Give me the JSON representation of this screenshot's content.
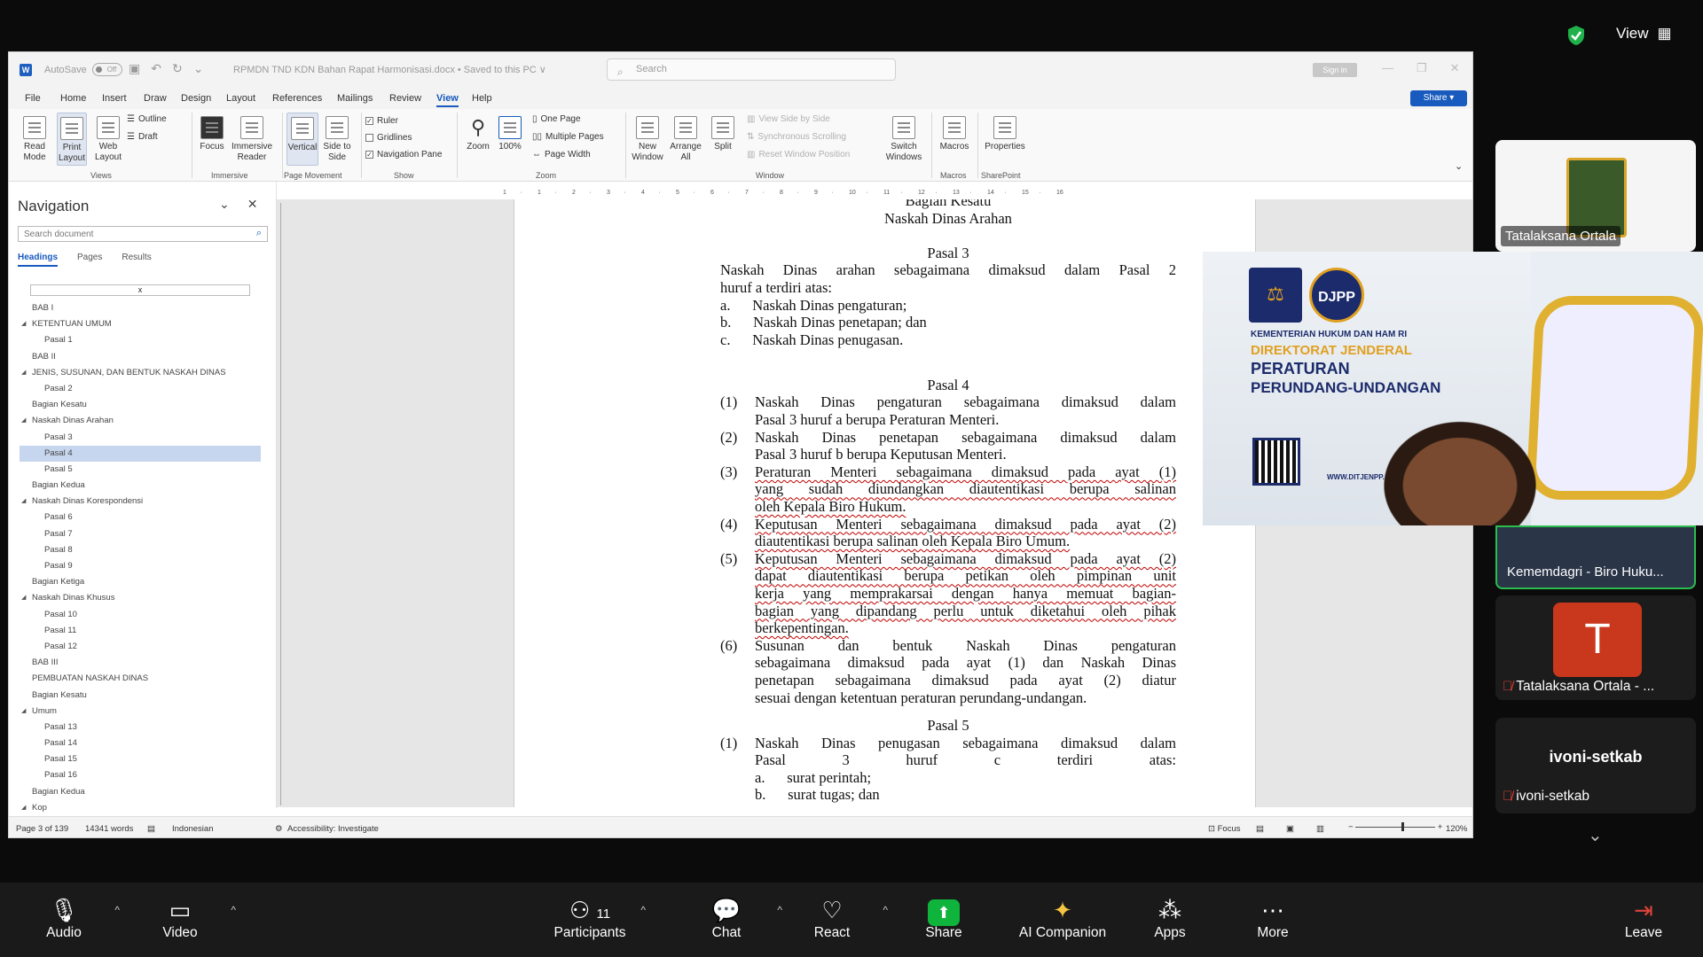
{
  "zoom_top": {
    "view_label": "View"
  },
  "word": {
    "autosave_label": "AutoSave",
    "autosave_state": "Off",
    "doc_title": "RPMDN TND KDN Bahan Rapat Harmonisasi.docx • Saved to this PC ∨",
    "search_placeholder": "Search",
    "sign_in": "Sign in",
    "share": "Share ▾",
    "menu": [
      "File",
      "Home",
      "Insert",
      "Draw",
      "Design",
      "Layout",
      "References",
      "Mailings",
      "Review",
      "View",
      "Help"
    ],
    "ribbon": {
      "views": {
        "read_mode": "Read Mode",
        "print_layout": "Print Layout",
        "web_layout": "Web Layout",
        "outline": "Outline",
        "draft": "Draft",
        "group": "Views"
      },
      "immersive": {
        "focus": "Focus",
        "immersive_reader": "Immersive Reader",
        "group": "Immersive"
      },
      "page_movement": {
        "vertical": "Vertical",
        "side_to_side": "Side to Side",
        "group": "Page Movement"
      },
      "show": {
        "ruler": "Ruler",
        "gridlines": "Gridlines",
        "navigation_pane": "Navigation Pane",
        "group": "Show"
      },
      "zoom": {
        "zoom": "Zoom",
        "hundred": "100%",
        "one_page": "One Page",
        "multiple_pages": "Multiple Pages",
        "page_width": "Page Width",
        "group": "Zoom"
      },
      "window": {
        "new_window": "New Window",
        "arrange_all": "Arrange All",
        "split": "Split",
        "view_side_by_side": "View Side by Side",
        "sync_scrolling": "Synchronous Scrolling",
        "reset_window": "Reset Window Position",
        "switch_windows": "Switch Windows",
        "group": "Window"
      },
      "macros": {
        "macros": "Macros",
        "group": "Macros"
      },
      "sharepoint": {
        "properties": "Properties",
        "group": "SharePoint"
      }
    },
    "nav": {
      "title": "Navigation",
      "search_placeholder": "Search document",
      "tabs": [
        "Headings",
        "Pages",
        "Results"
      ],
      "x_label": "x",
      "items": [
        {
          "label": "BAB I",
          "level": 1,
          "car": ""
        },
        {
          "label": "KETENTUAN UMUM",
          "level": 1,
          "car": "◢"
        },
        {
          "label": "Pasal 1",
          "level": 2,
          "car": ""
        },
        {
          "label": "BAB II",
          "level": 1,
          "car": ""
        },
        {
          "label": "JENIS, SUSUNAN, DAN BENTUK NASKAH DINAS",
          "level": 1,
          "car": "◢"
        },
        {
          "label": "Pasal 2",
          "level": 2,
          "car": ""
        },
        {
          "label": "Bagian Kesatu",
          "level": 1,
          "car": ""
        },
        {
          "label": "Naskah Dinas Arahan",
          "level": 1,
          "car": "◢"
        },
        {
          "label": "Pasal 3",
          "level": 2,
          "car": ""
        },
        {
          "label": "Pasal 4",
          "level": 2,
          "car": "",
          "selected": true
        },
        {
          "label": "Pasal 5",
          "level": 2,
          "car": ""
        },
        {
          "label": "Bagian Kedua",
          "level": 1,
          "car": ""
        },
        {
          "label": "Naskah Dinas Korespondensi",
          "level": 1,
          "car": "◢"
        },
        {
          "label": "Pasal 6",
          "level": 2,
          "car": ""
        },
        {
          "label": "Pasal 7",
          "level": 2,
          "car": ""
        },
        {
          "label": "Pasal 8",
          "level": 2,
          "car": ""
        },
        {
          "label": "Pasal 9",
          "level": 2,
          "car": ""
        },
        {
          "label": "Bagian Ketiga",
          "level": 1,
          "car": ""
        },
        {
          "label": "Naskah Dinas Khusus",
          "level": 1,
          "car": "◢"
        },
        {
          "label": "Pasal 10",
          "level": 2,
          "car": ""
        },
        {
          "label": "Pasal 11",
          "level": 2,
          "car": ""
        },
        {
          "label": "Pasal 12",
          "level": 2,
          "car": ""
        },
        {
          "label": "BAB III",
          "level": 1,
          "car": ""
        },
        {
          "label": "PEMBUATAN NASKAH DINAS",
          "level": 1,
          "car": ""
        },
        {
          "label": "Bagian Kesatu",
          "level": 1,
          "car": ""
        },
        {
          "label": "Umum",
          "level": 1,
          "car": "◢"
        },
        {
          "label": "Pasal 13",
          "level": 2,
          "car": ""
        },
        {
          "label": "Pasal 14",
          "level": 2,
          "car": ""
        },
        {
          "label": "Pasal 15",
          "level": 2,
          "car": ""
        },
        {
          "label": "Pasal 16",
          "level": 2,
          "car": ""
        },
        {
          "label": "Bagian Kedua",
          "level": 1,
          "car": ""
        },
        {
          "label": "Kop",
          "level": 1,
          "car": "◢"
        }
      ]
    },
    "ruler_numbers": [
      "1",
      "·",
      "1",
      "·",
      "2",
      "·",
      "3",
      "·",
      "4",
      "·",
      "5",
      "·",
      "6",
      "·",
      "7",
      "·",
      "8",
      "·",
      "9",
      "·",
      "10",
      "·",
      "11",
      "·",
      "12",
      "·",
      "13",
      "·",
      "14",
      "·",
      "15",
      "·",
      "16"
    ],
    "status": {
      "page": "Page 3 of 139",
      "words": "14341 words",
      "language": "Indonesian",
      "accessibility": "Accessibility: Investigate",
      "focus": "Focus",
      "zoom": "120%"
    }
  },
  "document": {
    "lines": [
      {
        "t": "Bagian Kesatu",
        "c": "ctr"
      },
      {
        "t": "Naskah Dinas Arahan",
        "c": "ctr"
      },
      {
        "t": "",
        "c": ""
      },
      {
        "t": "Pasal 3",
        "c": "ctr"
      },
      {
        "t": "Naskah Dinas arahan sebagaimana dimaksud dalam Pasal 2",
        "c": "just"
      },
      {
        "t": "huruf a terdiri atas:",
        "c": ""
      },
      {
        "t": "a.  Naskah Dinas pengaturan;",
        "c": ""
      },
      {
        "t": "b.  Naskah Dinas penetapan; dan",
        "c": ""
      },
      {
        "t": "c.  Naskah Dinas penugasan.",
        "c": ""
      }
    ],
    "pasal4_title": "Pasal 4",
    "pasal4": [
      {
        "n": "(1)",
        "lines": [
          "Naskah Dinas pengaturan sebagaimana dimaksud dalam",
          "Pasal 3 huruf a berupa Peraturan Menteri."
        ]
      },
      {
        "n": "(2)",
        "lines": [
          "Naskah Dinas penetapan sebagaimana dimaksud dalam",
          "Pasal 3 huruf b berupa Keputusan Menteri."
        ]
      },
      {
        "n": "(3)",
        "lines": [
          "Peraturan Menteri sebagaimana dimaksud pada ayat (1)",
          "yang sudah diundangkan diautentikasi berupa salinan",
          "oleh Kepala Biro Hukum."
        ],
        "u": true
      },
      {
        "n": "(4)",
        "lines": [
          "Keputusan Menteri sebagaimana dimaksud pada ayat (2)",
          "diautentikasi berupa salinan oleh Kepala Biro Umum."
        ],
        "u": true
      },
      {
        "n": "(5)",
        "lines": [
          "Keputusan Menteri sebagaimana dimaksud pada ayat (2)",
          "dapat diautentikasi berupa petikan oleh pimpinan unit",
          "kerja yang memprakarsai dengan hanya memuat bagian-",
          "bagian yang dipandang perlu untuk diketahui oleh pihak",
          "berkepentingan."
        ],
        "u": true
      },
      {
        "n": "(6)",
        "lines": [
          "Susunan dan bentuk Naskah Dinas pengaturan",
          "sebagaimana dimaksud pada ayat (1) dan Naskah Dinas",
          "penetapan sebagaimana dimaksud pada ayat (2) diatur",
          "sesuai dengan ketentuan peraturan perundang-undangan."
        ]
      }
    ],
    "pasal5_title": "Pasal 5",
    "pasal5": [
      {
        "n": "(1)",
        "lines": [
          "Naskah Dinas penugasan sebagaimana dimaksud dalam",
          "Pasal 3 huruf c terdiri atas:",
          "a.  surat perintah;",
          "b.  surat tugas; dan"
        ]
      }
    ]
  },
  "video": {
    "tile1_name": "Tatalaksana Ortala",
    "share_slide": {
      "ministry": "KEMENTERIAN HUKUM DAN HAM RI",
      "line2": "DIREKTORAT JENDERAL",
      "line3": "PERATURAN",
      "line4": "PERUNDANG-UNDANGAN",
      "djpp": "DJPP",
      "website": "WWW.DITJENPP..."
    },
    "tile2_name": "Kememdagri - Biro Huku...",
    "tile3_avatar": "T",
    "tile3_name": "Tatalaksana Ortala - ...",
    "tile4_big": "ivoni-setkab",
    "tile4_name": "ivoni-setkab"
  },
  "toolbar": {
    "audio": "Audio",
    "video": "Video",
    "participants": "Participants",
    "participants_count": "11",
    "chat": "Chat",
    "react": "React",
    "share": "Share",
    "ai": "AI Companion",
    "apps": "Apps",
    "more": "More",
    "leave": "Leave"
  }
}
